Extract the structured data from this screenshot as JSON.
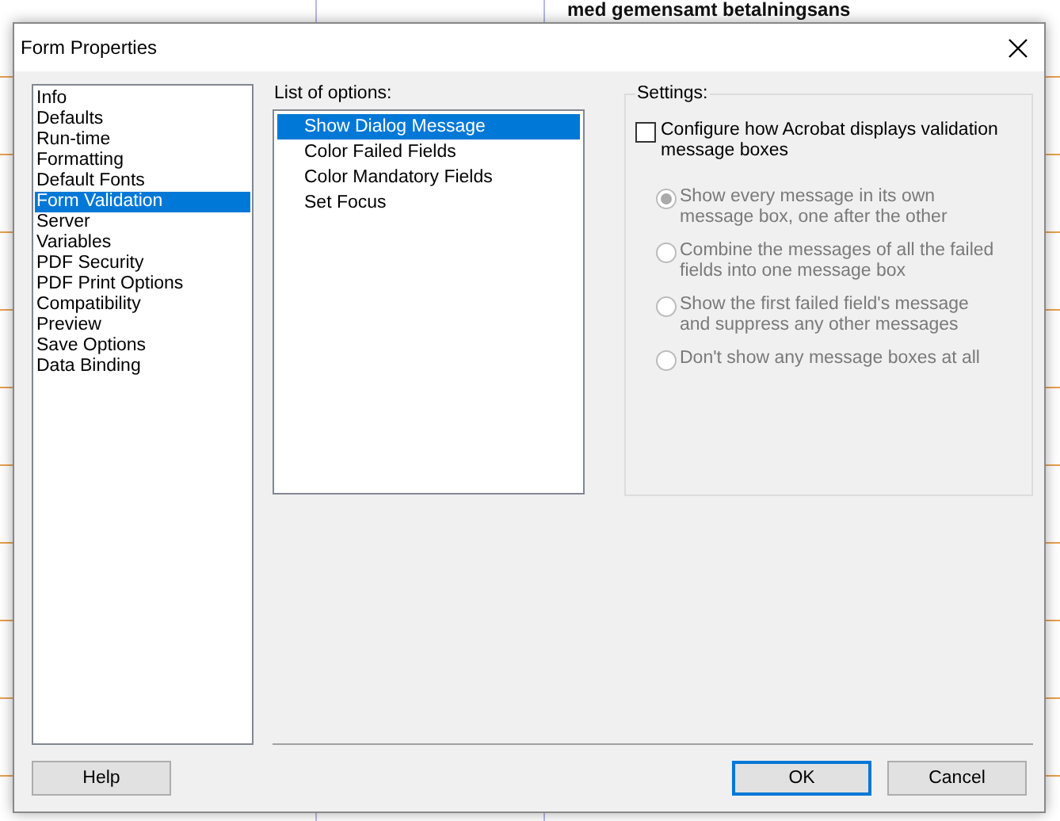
{
  "background": {
    "heading": "med gemensamt betalningsans"
  },
  "window": {
    "title": "Form Properties"
  },
  "sidebar": {
    "items": [
      {
        "label": "Info",
        "selected": false
      },
      {
        "label": "Defaults",
        "selected": false
      },
      {
        "label": "Run-time",
        "selected": false
      },
      {
        "label": "Formatting",
        "selected": false
      },
      {
        "label": "Default Fonts",
        "selected": false
      },
      {
        "label": "Form Validation",
        "selected": true
      },
      {
        "label": "Server",
        "selected": false
      },
      {
        "label": "Variables",
        "selected": false
      },
      {
        "label": "PDF Security",
        "selected": false
      },
      {
        "label": "PDF Print Options",
        "selected": false
      },
      {
        "label": "Compatibility",
        "selected": false
      },
      {
        "label": "Preview",
        "selected": false
      },
      {
        "label": "Save Options",
        "selected": false
      },
      {
        "label": "Data Binding",
        "selected": false
      }
    ]
  },
  "options": {
    "label": "List of options:",
    "items": [
      {
        "label": "Show Dialog Message",
        "selected": true
      },
      {
        "label": "Color Failed Fields",
        "selected": false
      },
      {
        "label": "Color Mandatory Fields",
        "selected": false
      },
      {
        "label": "Set Focus",
        "selected": false
      }
    ]
  },
  "settings": {
    "legend": "Settings:",
    "configure": {
      "label": "Configure how Acrobat displays validation message boxes",
      "checked": false
    },
    "radios": [
      {
        "label": "Show every message in its own message box, one after the other",
        "selected": true,
        "disabled": true
      },
      {
        "label": "Combine the messages of all the failed fields into one message box",
        "selected": false,
        "disabled": true
      },
      {
        "label": "Show the first failed field's message and suppress any other messages",
        "selected": false,
        "disabled": true
      },
      {
        "label": "Don't show any message boxes at all",
        "selected": false,
        "disabled": true
      }
    ]
  },
  "buttons": {
    "help": "Help",
    "ok": "OK",
    "cancel": "Cancel"
  }
}
